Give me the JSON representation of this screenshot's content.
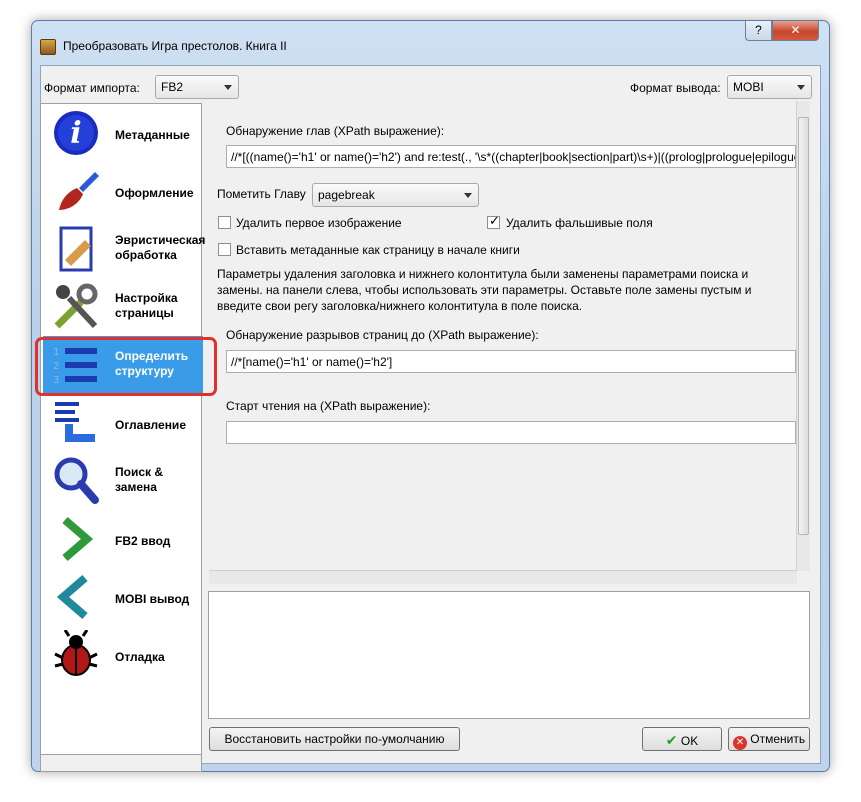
{
  "window": {
    "title": "Преобразовать Игра престолов. Книга II",
    "help_label": "?",
    "close_label": "✕"
  },
  "import_format": {
    "label": "Формат импорта:",
    "value": "FB2"
  },
  "output_format": {
    "label": "Формат вывода:",
    "value": "MOBI"
  },
  "sidebar": {
    "items": [
      {
        "label": "Метаданные",
        "icon": "info-icon"
      },
      {
        "label": "Оформление",
        "icon": "paintbrush-icon"
      },
      {
        "label": "Эвристическая обработка",
        "icon": "document-bandage-icon"
      },
      {
        "label": "Настройка страницы",
        "icon": "tools-icon"
      },
      {
        "label": "Определить структуру",
        "icon": "numbered-list-icon",
        "selected": true
      },
      {
        "label": "Оглавление",
        "icon": "toc-icon"
      },
      {
        "label": "Поиск & замена",
        "icon": "magnifier-icon"
      },
      {
        "label": "FB2 ввод",
        "icon": "chevron-right-icon"
      },
      {
        "label": "MOBI вывод",
        "icon": "chevron-left-icon"
      },
      {
        "label": "Отладка",
        "icon": "bug-icon"
      }
    ]
  },
  "main": {
    "chapter_detect_label": "Обнаружение глав (XPath выражение):",
    "chapter_detect_value": "//*[((name()='h1' or name()='h2') and re:test(., '\\s*((chapter|book|section|part)\\s+)|((prolog|prologue|epilogue",
    "mark_chapter_label": "Пометить Главу",
    "mark_chapter_value": "pagebreak",
    "remove_first_image_label": "Удалить первое изображение",
    "remove_first_image_checked": false,
    "remove_fake_margins_label": "Удалить фальшивые поля",
    "remove_fake_margins_checked": true,
    "insert_metadata_label": "Вставить метаданные как страницу в начале книги",
    "insert_metadata_checked": false,
    "info_text": "Параметры удаления заголовка и нижнего колонтитула были заменены параметрами поиска и замены. на панели слева, чтобы использовать эти параметры. Оставьте поле замены пустым и введите свои регу заголовка/нижнего колонтитула в поле поиска.",
    "page_break_label": "Обнаружение разрывов страниц до (XPath выражение):",
    "page_break_value": "//*[name()='h1' or name()='h2']",
    "start_reading_label": "Старт чтения на (XPath выражение):",
    "start_reading_value": ""
  },
  "buttons": {
    "restore_defaults": "Восстановить настройки по-умолчанию",
    "ok": "OK",
    "cancel": "Отменить"
  }
}
